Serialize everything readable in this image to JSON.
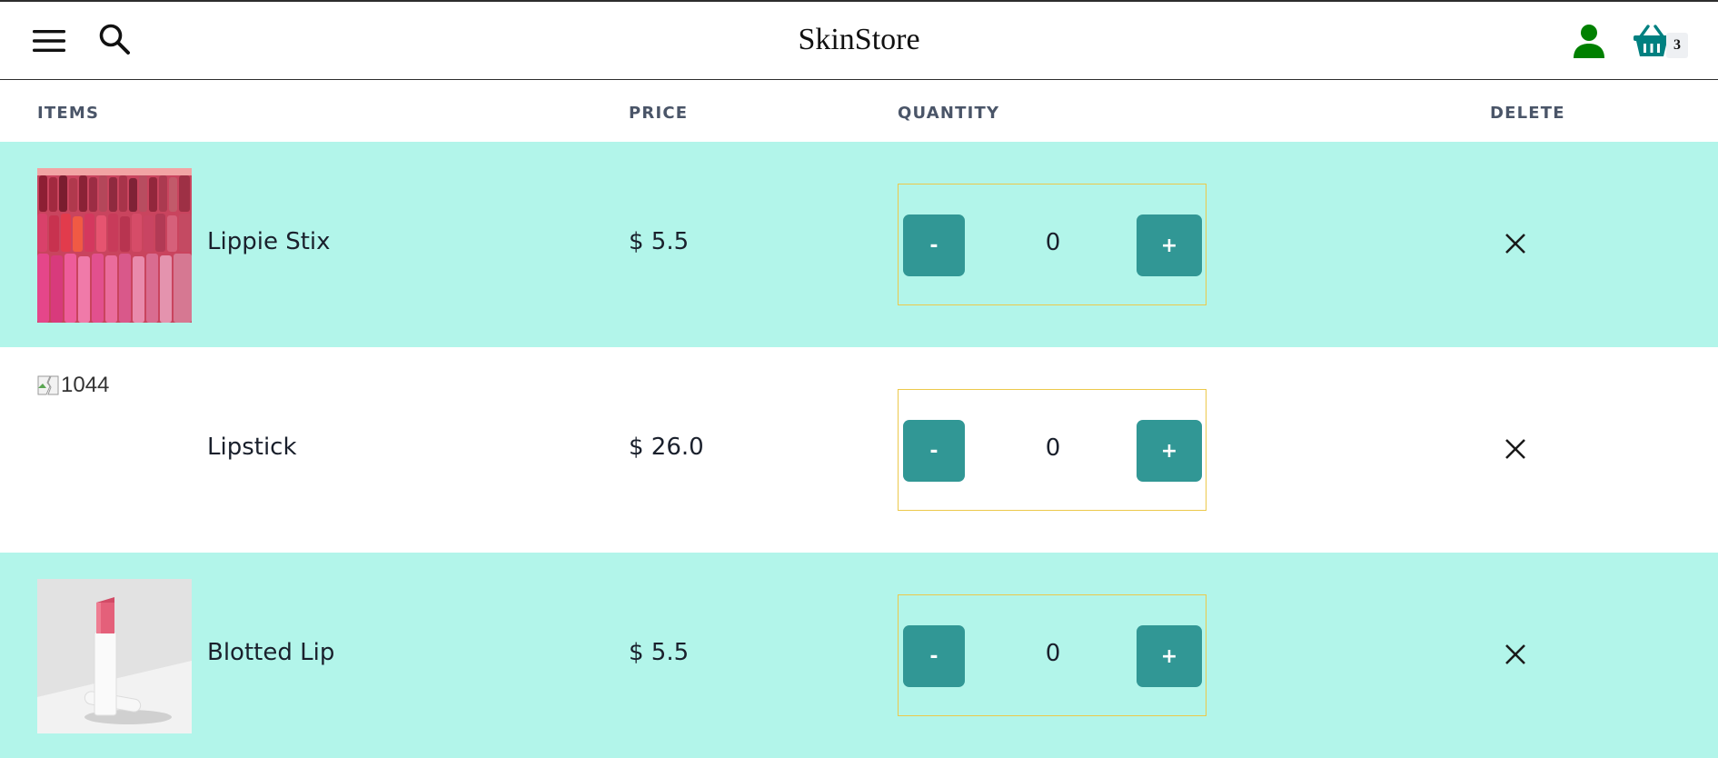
{
  "header": {
    "brand": "SkinStore",
    "cart_count": "3",
    "icons": {
      "menu": "hamburger-menu-icon",
      "search": "search-icon",
      "user": "user-icon",
      "cart": "basket-icon"
    },
    "colors": {
      "user_icon": "#008000",
      "cart_icon": "#008080"
    }
  },
  "table": {
    "headers": {
      "items": "ITEMS",
      "price": "PRICE",
      "quantity": "QUANTITY",
      "delete": "DELETE"
    },
    "rows": [
      {
        "name": "Lippie Stix",
        "price": "$ 5.5",
        "quantity": "0",
        "image": "lipsticks-photo",
        "minus": "-",
        "plus": "+"
      },
      {
        "name": "Lipstick",
        "price": "$ 26.0",
        "quantity": "0",
        "image_alt": "1044",
        "minus": "-",
        "plus": "+"
      },
      {
        "name": "Blotted Lip",
        "price": "$ 5.5",
        "quantity": "0",
        "image": "single-lipstick-photo",
        "minus": "-",
        "plus": "+"
      }
    ]
  },
  "colors": {
    "row_alt": "#b2f5ea",
    "button": "#319795",
    "qty_border": "#ecc94b"
  }
}
